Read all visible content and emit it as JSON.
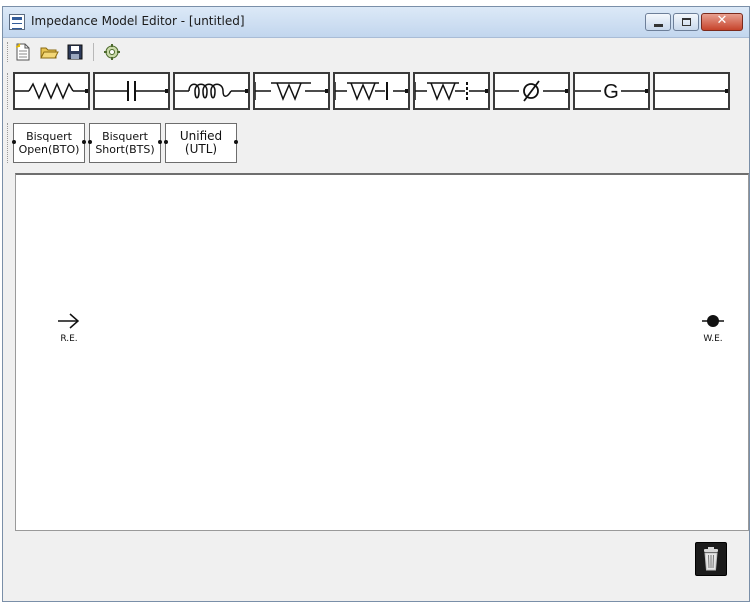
{
  "window": {
    "title": "Impedance Model Editor - [untitled]"
  },
  "toolbar": {
    "icons": [
      "new-file-icon",
      "open-folder-icon",
      "save-disk-icon",
      "settings-icon"
    ]
  },
  "components": [
    {
      "name": "resistor",
      "icon": "resistor-icon"
    },
    {
      "name": "capacitor",
      "icon": "capacitor-icon"
    },
    {
      "name": "inductor",
      "icon": "inductor-icon"
    },
    {
      "name": "warburg",
      "icon": "warburg-icon"
    },
    {
      "name": "warburg-open",
      "icon": "warburg-open-icon"
    },
    {
      "name": "warburg-short",
      "icon": "warburg-short-icon"
    },
    {
      "name": "cpe",
      "icon": "cpe-icon"
    },
    {
      "name": "gerischer",
      "icon": "gerischer-icon",
      "label": "G"
    },
    {
      "name": "wire",
      "icon": "wire-icon"
    }
  ],
  "model_buttons": {
    "bto": "Bisquert\nOpen(BTO)",
    "bts": "Bisquert\nShort(BTS)",
    "utl": "Unified\n(UTL)"
  },
  "canvas": {
    "re_label": "R.E.",
    "we_label": "W.E."
  },
  "colors": {
    "title_bar": "#c2d6ee",
    "close_button": "#c6432b",
    "canvas": "#ffffff"
  }
}
